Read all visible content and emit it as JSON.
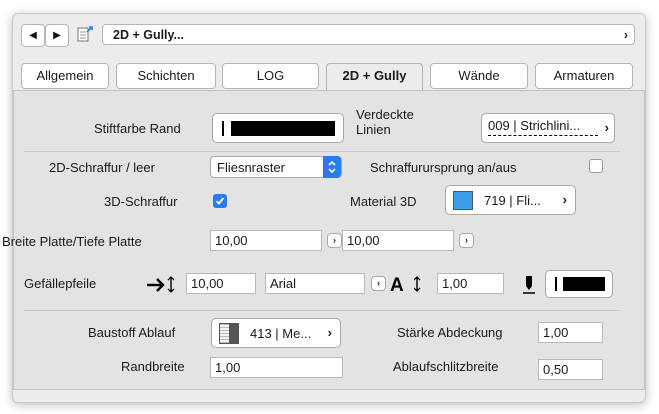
{
  "nav": {
    "title": "2D + Gully...",
    "chevron": "›"
  },
  "tabs": [
    {
      "label": "Allgemein"
    },
    {
      "label": "Schichten"
    },
    {
      "label": "LOG"
    },
    {
      "label": "2D + Gully",
      "active": true
    },
    {
      "label": "Wände"
    },
    {
      "label": "Armaturen"
    }
  ],
  "fields": {
    "stiftfarbe_label": "Stiftfarbe Rand",
    "verdeckte_label": "Verdeckte\nLinien",
    "verdeckte_value": "009 | Strichlini...",
    "schraffur2d_label": "2D-Schraffur / leer",
    "schraffur2d_value": "Fliesnraster",
    "schraffurursprung_label": "Schraffurursprung an/aus",
    "schraffurursprung_checked": false,
    "schraffur3d_label": "3D-Schraffur",
    "schraffur3d_checked": true,
    "material3d_label": "Material 3D",
    "material3d_value": "719 | Fli...",
    "material3d_color": "#3b9ee8",
    "breite_label": "Breite Platte/Tiefe Platte",
    "breite_value": "10,00",
    "tiefe_value": "10,00",
    "gefaelle_label": "Gefällepfeile",
    "gefaelle_value": "10,00",
    "font_value": "Arial",
    "fontsize_value": "1,00",
    "baustoff_label": "Baustoff Ablauf",
    "baustoff_value": "413 | Me...",
    "staerke_label": "Stärke Abdeckung",
    "staerke_value": "1,00",
    "randbreite_label": "Randbreite",
    "randbreite_value": "1,00",
    "ablauf_label": "Ablaufschlitzbreite",
    "ablauf_value": "0,50"
  },
  "colors": {
    "accent": "#2a7bef",
    "pen_black": "#000000"
  },
  "icons": {
    "back": "◀",
    "forward": "▶",
    "chevron": "›"
  }
}
